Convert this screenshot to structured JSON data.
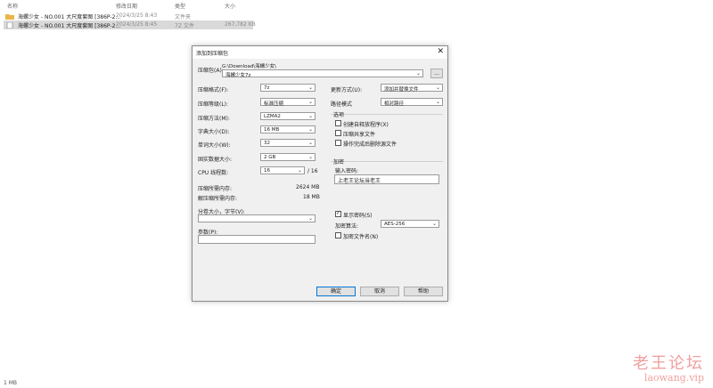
{
  "explorer": {
    "columns": {
      "name": "名称",
      "date": "修改日期",
      "type": "类型",
      "size": "大小"
    },
    "rows": [
      {
        "name": "海螺少女 - NO.001 大尺度套图 [386P-2...",
        "date": "2024/3/25 8:43",
        "type": "文件夹",
        "size": ""
      },
      {
        "name": "海螺少女 - NO.001 大尺度套图 [386P-2...",
        "date": "2024/3/25 8:45",
        "type": "7Z 文件",
        "size": "267,782 KB"
      }
    ],
    "status": "1 MB"
  },
  "dialog": {
    "title": "添加到压缩包",
    "close": "✕",
    "archive_label": "压缩包(A):",
    "archive_path": "G:\\Download\\海螺少女\\",
    "archive_name": "海螺少女7z",
    "browse": "...",
    "format_label": "压缩格式(F):",
    "format_value": "7z",
    "level_label": "压缩等级(L):",
    "level_value": "标准压缩",
    "method_label": "压缩方法(M):",
    "method_value": "LZMA2",
    "dict_label": "字典大小(D):",
    "dict_value": "16 MB",
    "word_label": "单词大小(W):",
    "word_value": "32",
    "solid_label": "固实数据大小:",
    "solid_value": "2 GB",
    "cpu_label": "CPU 线程数:",
    "cpu_value": "16",
    "cpu_max": "/ 16",
    "mem_comp_label": "压缩所需内存:",
    "mem_comp_value": "2624 MB",
    "mem_decomp_label": "解压缩所需内存:",
    "mem_decomp_value": "18 MB",
    "split_label": "分卷大小，字节(V):",
    "split_value": "",
    "params_label": "参数(P):",
    "params_value": "",
    "update_label": "更新方式(U):",
    "update_value": "添加并替换文件",
    "path_label": "路径模式",
    "path_value": "相对路径",
    "options_label": "选项",
    "opt_sfx": "创建自释放程序(X)",
    "opt_shared": "压缩共享文件",
    "opt_delete": "操作完成后删除源文件",
    "encrypt_label": "加密",
    "password_label": "输入密码:",
    "password_value": "上老王论坛当老王",
    "show_password": "显示密码(S)",
    "method_enc_label": "加密算法:",
    "method_enc_value": "AES-256",
    "encrypt_names": "加密文件名(N)",
    "ok": "确定",
    "cancel": "取消",
    "help": "帮助",
    "checkmark": "✓",
    "arrow": "⌄"
  },
  "watermark": {
    "cn": "老王论坛",
    "en": "laowang.vip"
  }
}
